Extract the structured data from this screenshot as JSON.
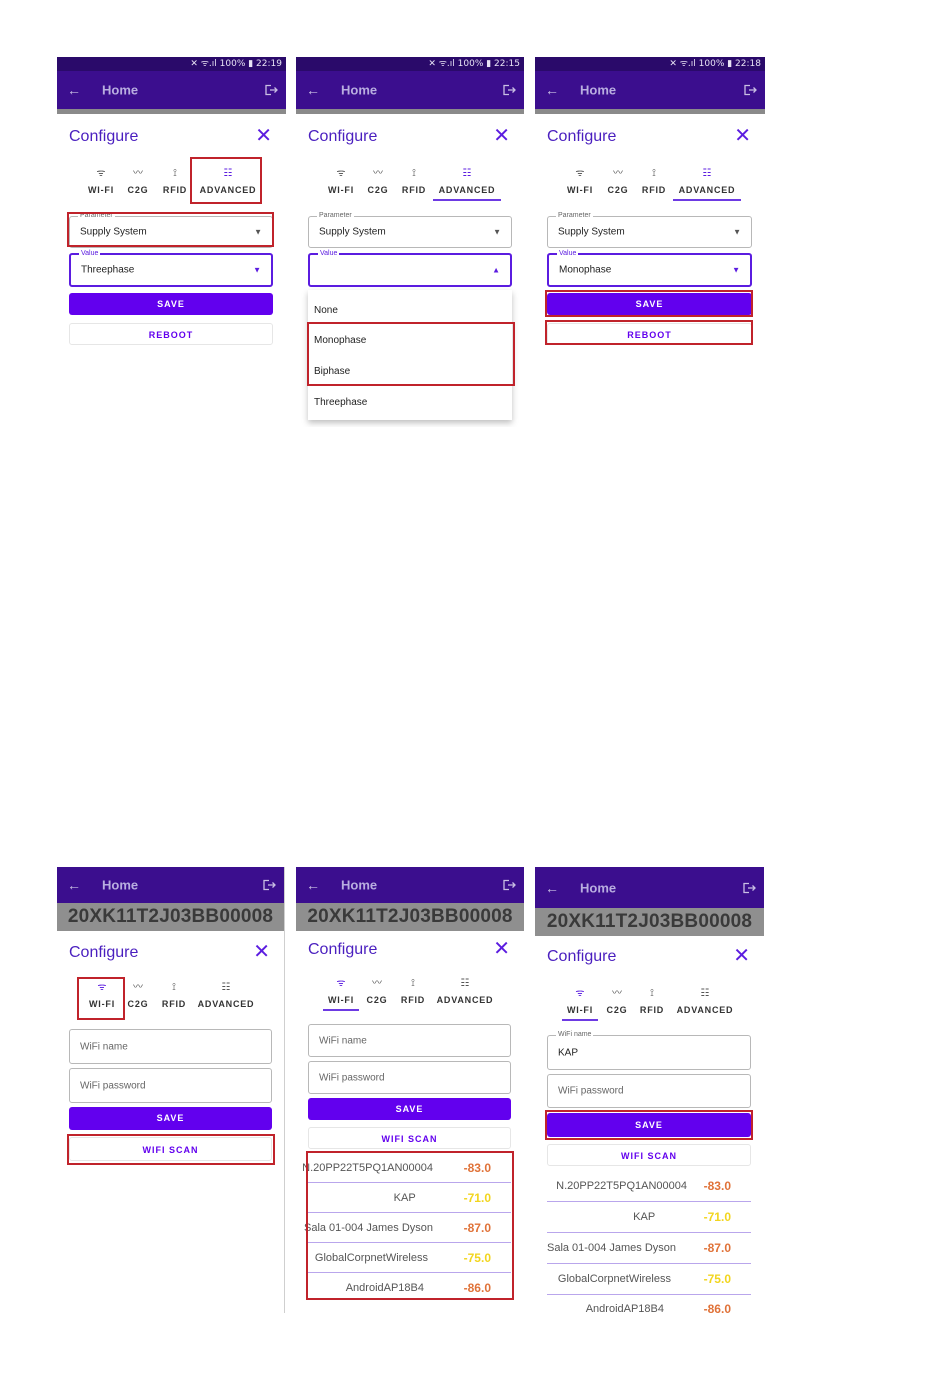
{
  "colors": {
    "accent": "#6200ee",
    "appbar": "#3b0e8e",
    "highlight": "#c0232b",
    "rssi_bad": "#e07238",
    "rssi_mid": "#f2d51e"
  },
  "app": {
    "home_title": "Home",
    "back_icon": "arrow-left-icon",
    "exit_icon": "exit-icon"
  },
  "serial": "20XK11T2J03BB00008",
  "configure": {
    "title": "Configure"
  },
  "tabs": [
    {
      "label": "WI-FI",
      "icon": "wifi-icon"
    },
    {
      "label": "C2G",
      "icon": "chart-line-icon"
    },
    {
      "label": "RFID",
      "icon": "rfid-icon"
    },
    {
      "label": "ADVANCED",
      "icon": "sliders-icon"
    }
  ],
  "screens": {
    "s1": {
      "status": "✕ ᯤ.ıl 100% ▮ 22:19",
      "parameter_label": "Parameter",
      "parameter_value": "Supply System",
      "value_label": "Value",
      "value_value": "Threephase",
      "save": "SAVE",
      "reboot": "REBOOT"
    },
    "s2": {
      "status": "✕ ᯤ.ıl 100% ▮ 22:15",
      "parameter_label": "Parameter",
      "parameter_value": "Supply System",
      "value_label": "Value",
      "options": [
        "None",
        "Monophase",
        "Biphase",
        "Threephase"
      ]
    },
    "s3": {
      "status": "✕ ᯤ.ıl 100% ▮ 22:18",
      "parameter_label": "Parameter",
      "parameter_value": "Supply System",
      "value_label": "Value",
      "value_value": "Monophase",
      "save": "SAVE",
      "reboot": "REBOOT"
    },
    "s4": {
      "wifi_name_placeholder": "WiFi name",
      "wifi_password_placeholder": "WiFi password",
      "save": "SAVE",
      "wifi_scan": "WIFI SCAN"
    },
    "s5": {
      "wifi_name_placeholder": "WiFi name",
      "wifi_password_placeholder": "WiFi password",
      "save": "SAVE",
      "wifi_scan": "WIFI SCAN"
    },
    "s6": {
      "wifi_name_label": "WiFi name",
      "wifi_name_value": "KAP",
      "wifi_password_placeholder": "WiFi password",
      "save": "SAVE",
      "wifi_scan": "WIFI SCAN"
    }
  },
  "networks": [
    {
      "ssid": "N.20PP22T5PQ1AN00004",
      "rssi": "-83.0",
      "level": "bad"
    },
    {
      "ssid": "KAP",
      "rssi": "-71.0",
      "level": "mid"
    },
    {
      "ssid": "Sala 01-004 James Dyson",
      "rssi": "-87.0",
      "level": "bad"
    },
    {
      "ssid": "GlobalCorpnetWireless",
      "rssi": "-75.0",
      "level": "mid"
    },
    {
      "ssid": "AndroidAP18B4",
      "rssi": "-86.0",
      "level": "bad"
    }
  ]
}
